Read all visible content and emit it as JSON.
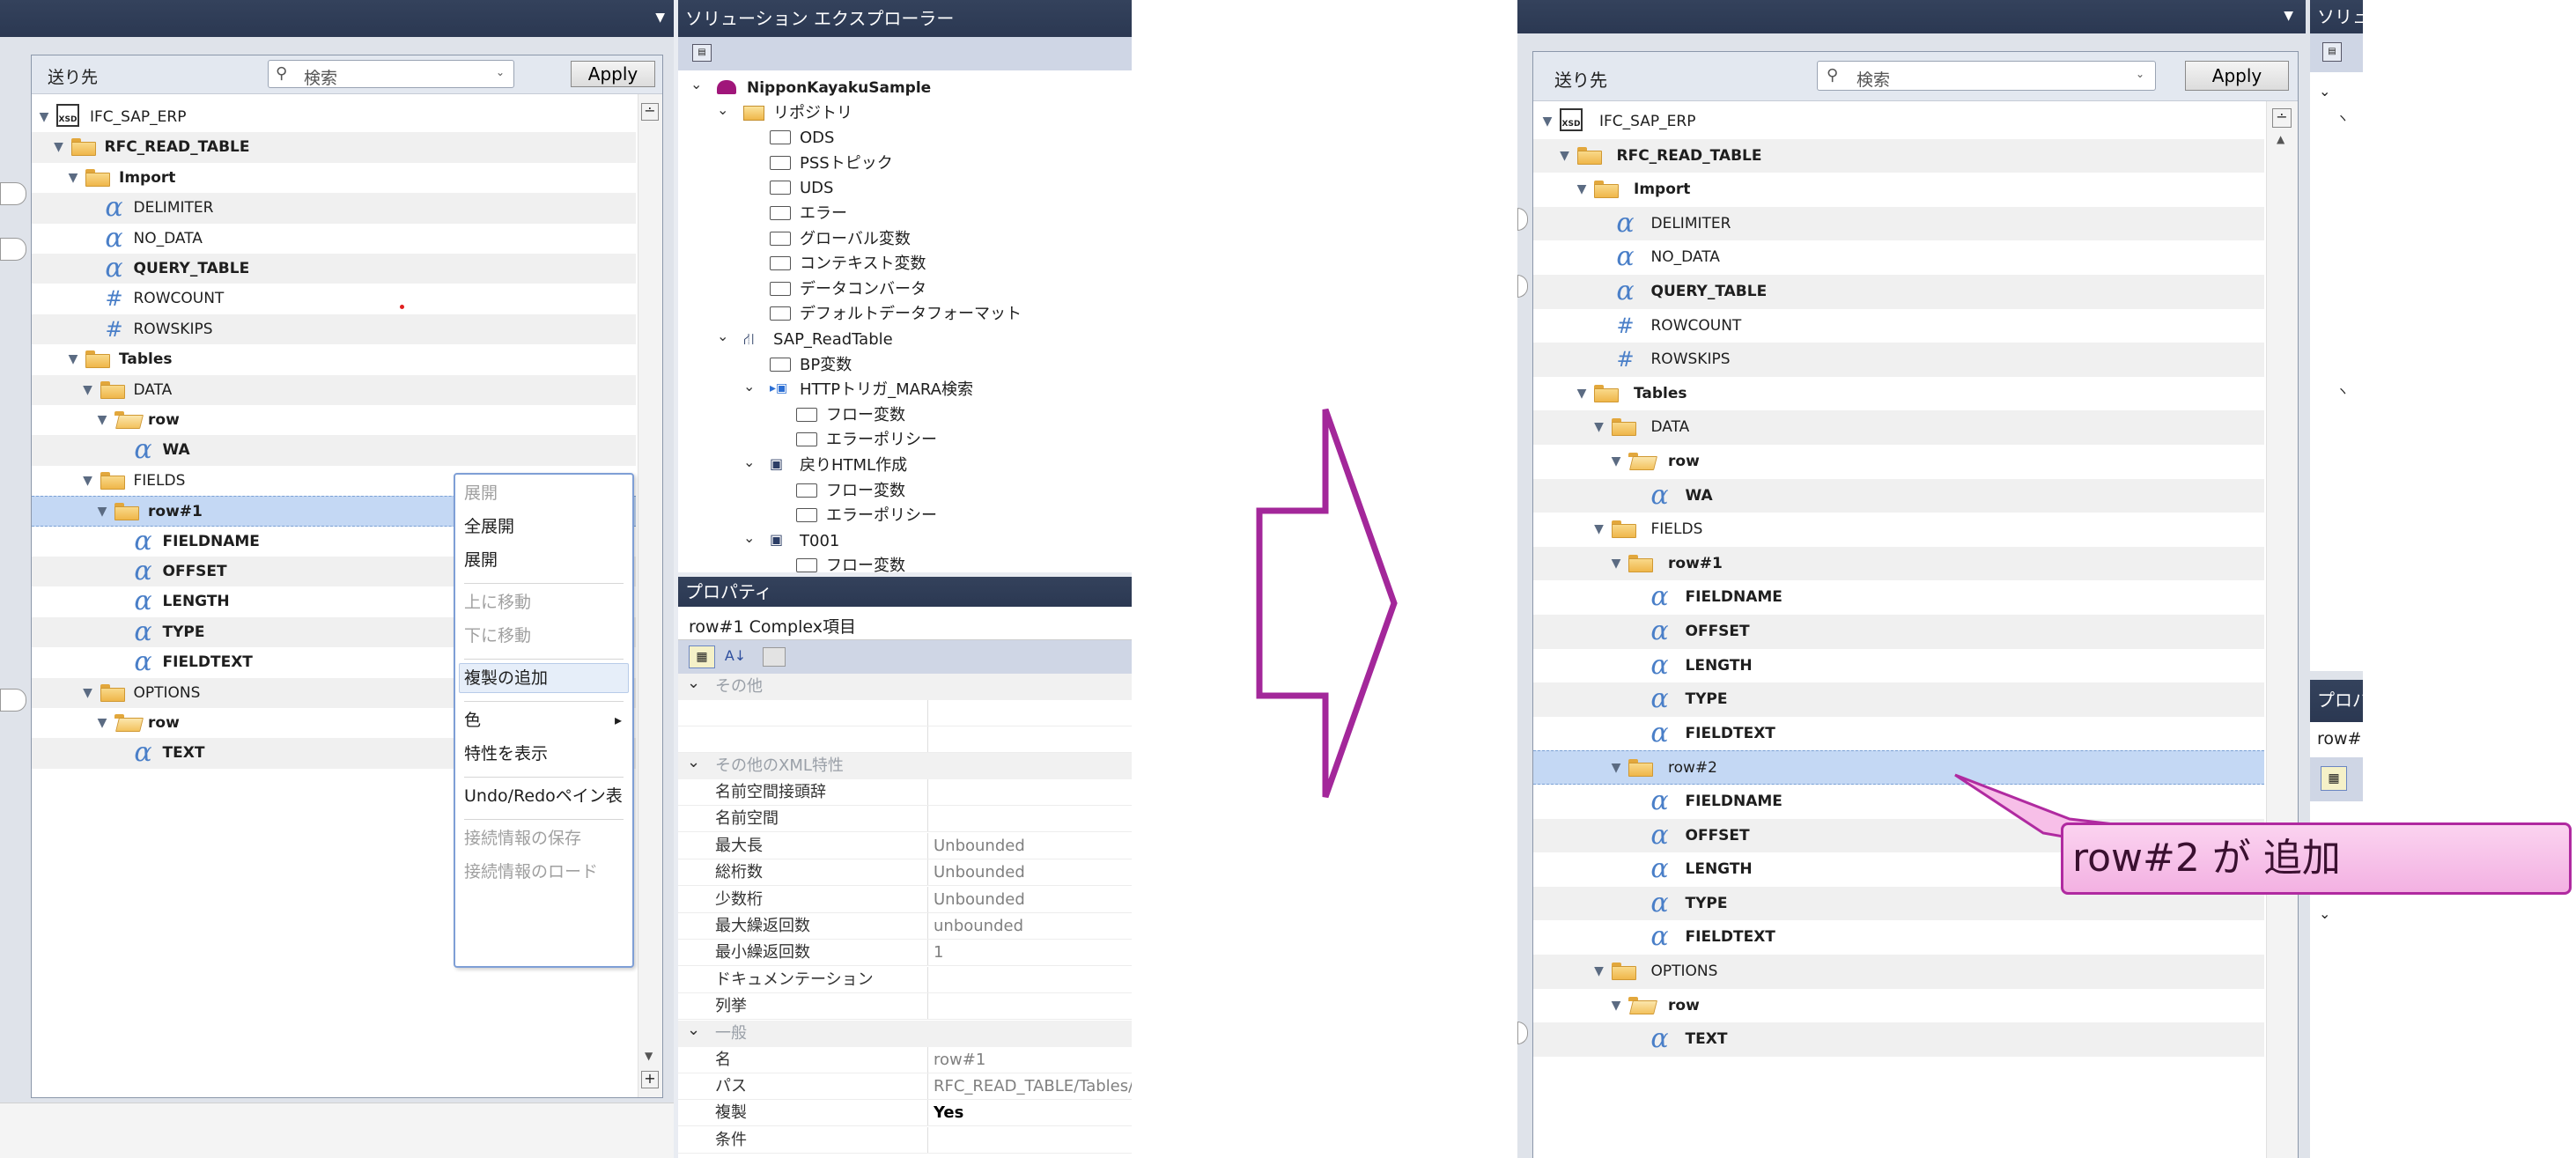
{
  "left": {
    "explorer_title": "ソリューション エクスプローラー",
    "properties_title": "プロパティ",
    "dest_label": "送り先",
    "search_placeholder": "検索",
    "apply_label": "Apply",
    "tree": [
      {
        "label": "IFC_SAP_ERP",
        "depth": 0,
        "icon": "xsd-icon",
        "bold": false
      },
      {
        "label": "RFC_READ_TABLE",
        "depth": 1,
        "icon": "folder-open-icon",
        "bold": true
      },
      {
        "label": "Import",
        "depth": 2,
        "icon": "folder-open-icon",
        "bold": true
      },
      {
        "label": "DELIMITER",
        "depth": 3,
        "icon": "alpha-icon",
        "bold": false
      },
      {
        "label": "NO_DATA",
        "depth": 3,
        "icon": "alpha-icon",
        "bold": false
      },
      {
        "label": "QUERY_TABLE",
        "depth": 3,
        "icon": "alpha-icon",
        "bold": true
      },
      {
        "label": "ROWCOUNT",
        "depth": 3,
        "icon": "hash-icon",
        "bold": false
      },
      {
        "label": "ROWSKIPS",
        "depth": 3,
        "icon": "hash-icon",
        "bold": false
      },
      {
        "label": "Tables",
        "depth": 2,
        "icon": "folder-open-icon",
        "bold": true
      },
      {
        "label": "DATA",
        "depth": 3,
        "icon": "folder-open-icon",
        "bold": false
      },
      {
        "label": "row",
        "depth": 4,
        "icon": "folder-repeat-icon",
        "bold": true
      },
      {
        "label": "WA",
        "depth": 5,
        "icon": "alpha-icon",
        "bold": true
      },
      {
        "label": "FIELDS",
        "depth": 3,
        "icon": "folder-open-icon",
        "bold": false
      },
      {
        "label": "row#1",
        "depth": 4,
        "icon": "folder-open-icon",
        "bold": true,
        "selected": true
      },
      {
        "label": "FIELDNAME",
        "depth": 5,
        "icon": "alpha-icon",
        "bold": true
      },
      {
        "label": "OFFSET",
        "depth": 5,
        "icon": "alpha-icon",
        "bold": true
      },
      {
        "label": "LENGTH",
        "depth": 5,
        "icon": "alpha-icon",
        "bold": true
      },
      {
        "label": "TYPE",
        "depth": 5,
        "icon": "alpha-icon",
        "bold": true
      },
      {
        "label": "FIELDTEXT",
        "depth": 5,
        "icon": "alpha-icon",
        "bold": true
      },
      {
        "label": "OPTIONS",
        "depth": 3,
        "icon": "folder-open-icon",
        "bold": false
      },
      {
        "label": "row",
        "depth": 4,
        "icon": "folder-repeat-icon",
        "bold": true
      },
      {
        "label": "TEXT",
        "depth": 5,
        "icon": "alpha-icon",
        "bold": true
      }
    ],
    "context_menu": [
      {
        "label": "展開",
        "disabled": true
      },
      {
        "label": "全展開",
        "disabled": false
      },
      {
        "label": "展開",
        "disabled": false
      },
      {
        "label": "",
        "separator": true
      },
      {
        "label": "上に移動",
        "disabled": true
      },
      {
        "label": "下に移動",
        "disabled": true
      },
      {
        "label": "",
        "separator": true
      },
      {
        "label": "複製の追加",
        "disabled": false,
        "highlight": true
      },
      {
        "label": "",
        "separator": true
      },
      {
        "label": "色",
        "disabled": false,
        "submenu": true
      },
      {
        "label": "特性を表示",
        "disabled": false
      },
      {
        "label": "",
        "separator": true
      },
      {
        "label": "Undo/Redoペイン表",
        "disabled": false
      },
      {
        "label": "",
        "separator": true
      },
      {
        "label": "接続情報の保存",
        "disabled": true
      },
      {
        "label": "接続情報のロード",
        "disabled": true
      }
    ],
    "solution_tree": [
      {
        "label": "NipponKayakuSample",
        "indent": 0,
        "arrow": "v",
        "icon": "solution",
        "bold": true
      },
      {
        "label": "リポジトリ",
        "indent": 1,
        "arrow": "v",
        "icon": "yfolder"
      },
      {
        "label": "ODS",
        "indent": 2,
        "icon": "ofolder"
      },
      {
        "label": "PSSトピック",
        "indent": 2,
        "icon": "ofolder"
      },
      {
        "label": "UDS",
        "indent": 2,
        "icon": "ofolder"
      },
      {
        "label": "エラー",
        "indent": 2,
        "icon": "ofolder"
      },
      {
        "label": "グローバル変数",
        "indent": 2,
        "icon": "ofolder"
      },
      {
        "label": "コンテキスト変数",
        "indent": 2,
        "icon": "ofolder"
      },
      {
        "label": "データコンバータ",
        "indent": 2,
        "icon": "ofolder"
      },
      {
        "label": "デフォルトデータフォーマット",
        "indent": 2,
        "icon": "ofolder"
      },
      {
        "label": "SAP_ReadTable",
        "indent": 1,
        "arrow": "v",
        "icon": "network"
      },
      {
        "label": "BP変数",
        "indent": 2,
        "icon": "ofolder"
      },
      {
        "label": "HTTPトリガ_MARA検索",
        "indent": 2,
        "arrow": "v",
        "icon": "trigger"
      },
      {
        "label": "フロー変数",
        "indent": 3,
        "icon": "ofolder"
      },
      {
        "label": "エラーポリシー",
        "indent": 3,
        "icon": "ofolder"
      },
      {
        "label": "戻りHTML作成",
        "indent": 2,
        "arrow": "v",
        "icon": "node"
      },
      {
        "label": "フロー変数",
        "indent": 3,
        "icon": "ofolder"
      },
      {
        "label": "エラーポリシー",
        "indent": 3,
        "icon": "ofolder"
      },
      {
        "label": "T001",
        "indent": 2,
        "arrow": "v",
        "icon": "node"
      },
      {
        "label": "フロー変数",
        "indent": 3,
        "icon": "ofolder"
      }
    ],
    "properties": {
      "object_label": "row#1  Complex項目",
      "cat_other": "その他",
      "cat_xml": "その他のXML特性",
      "cat_general": "一般",
      "xml_rows": [
        {
          "k": "名前空間接頭辞",
          "v": ""
        },
        {
          "k": "名前空間",
          "v": ""
        },
        {
          "k": "最大長",
          "v": "Unbounded"
        },
        {
          "k": "総桁数",
          "v": "Unbounded"
        },
        {
          "k": "少数桁",
          "v": "Unbounded"
        },
        {
          "k": "最大繰返回数",
          "v": "unbounded"
        },
        {
          "k": "最小繰返回数",
          "v": "1"
        },
        {
          "k": "ドキュメンテーション",
          "v": ""
        },
        {
          "k": "列挙",
          "v": ""
        }
      ],
      "general_rows": [
        {
          "k": "名",
          "v": "row#1"
        },
        {
          "k": "パス",
          "v": "RFC_READ_TABLE/Tables/F"
        },
        {
          "k": "複製",
          "v": "Yes",
          "bold": true
        },
        {
          "k": "条件",
          "v": ""
        }
      ]
    }
  },
  "right": {
    "explorer_title": "ソリュー",
    "properties_title": "プロパ",
    "properties_row": "row#",
    "dest_label": "送り先",
    "search_placeholder": "検索",
    "apply_label": "Apply",
    "tree": [
      {
        "label": "IFC_SAP_ERP",
        "depth": 0,
        "icon": "xsd-icon",
        "bold": false
      },
      {
        "label": "RFC_READ_TABLE",
        "depth": 1,
        "icon": "folder-open-icon",
        "bold": true
      },
      {
        "label": "Import",
        "depth": 2,
        "icon": "folder-open-icon",
        "bold": true
      },
      {
        "label": "DELIMITER",
        "depth": 3,
        "icon": "alpha-icon",
        "bold": false
      },
      {
        "label": "NO_DATA",
        "depth": 3,
        "icon": "alpha-icon",
        "bold": false
      },
      {
        "label": "QUERY_TABLE",
        "depth": 3,
        "icon": "alpha-icon",
        "bold": true
      },
      {
        "label": "ROWCOUNT",
        "depth": 3,
        "icon": "hash-icon",
        "bold": false
      },
      {
        "label": "ROWSKIPS",
        "depth": 3,
        "icon": "hash-icon",
        "bold": false
      },
      {
        "label": "Tables",
        "depth": 2,
        "icon": "folder-open-icon",
        "bold": true
      },
      {
        "label": "DATA",
        "depth": 3,
        "icon": "folder-open-icon",
        "bold": false
      },
      {
        "label": "row",
        "depth": 4,
        "icon": "folder-repeat-icon",
        "bold": true
      },
      {
        "label": "WA",
        "depth": 5,
        "icon": "alpha-icon",
        "bold": true
      },
      {
        "label": "FIELDS",
        "depth": 3,
        "icon": "folder-open-icon",
        "bold": false
      },
      {
        "label": "row#1",
        "depth": 4,
        "icon": "folder-open-icon",
        "bold": true
      },
      {
        "label": "FIELDNAME",
        "depth": 5,
        "icon": "alpha-icon",
        "bold": true
      },
      {
        "label": "OFFSET",
        "depth": 5,
        "icon": "alpha-icon",
        "bold": true
      },
      {
        "label": "LENGTH",
        "depth": 5,
        "icon": "alpha-icon",
        "bold": true
      },
      {
        "label": "TYPE",
        "depth": 5,
        "icon": "alpha-icon",
        "bold": true
      },
      {
        "label": "FIELDTEXT",
        "depth": 5,
        "icon": "alpha-icon",
        "bold": true
      },
      {
        "label": "row#2",
        "depth": 4,
        "icon": "folder-open-icon",
        "bold": false,
        "selected": true
      },
      {
        "label": "FIELDNAME",
        "depth": 5,
        "icon": "alpha-icon",
        "bold": true
      },
      {
        "label": "OFFSET",
        "depth": 5,
        "icon": "alpha-icon",
        "bold": true
      },
      {
        "label": "LENGTH",
        "depth": 5,
        "icon": "alpha-icon",
        "bold": true
      },
      {
        "label": "TYPE",
        "depth": 5,
        "icon": "alpha-icon",
        "bold": true
      },
      {
        "label": "FIELDTEXT",
        "depth": 5,
        "icon": "alpha-icon",
        "bold": true
      },
      {
        "label": "OPTIONS",
        "depth": 3,
        "icon": "folder-open-icon",
        "bold": false
      },
      {
        "label": "row",
        "depth": 4,
        "icon": "folder-repeat-icon",
        "bold": true
      },
      {
        "label": "TEXT",
        "depth": 5,
        "icon": "alpha-icon",
        "bold": true
      }
    ]
  },
  "annotation": {
    "callout_text": "row#2 が 追加",
    "arrow_color": "#a3279a",
    "callout_bg": "#f7bfe8",
    "callout_border": "#b02aa0"
  },
  "colors": {
    "titlebar": "#2f3c56",
    "selection": "#c4d8f4",
    "icon_blue": "#4a7fc8"
  }
}
